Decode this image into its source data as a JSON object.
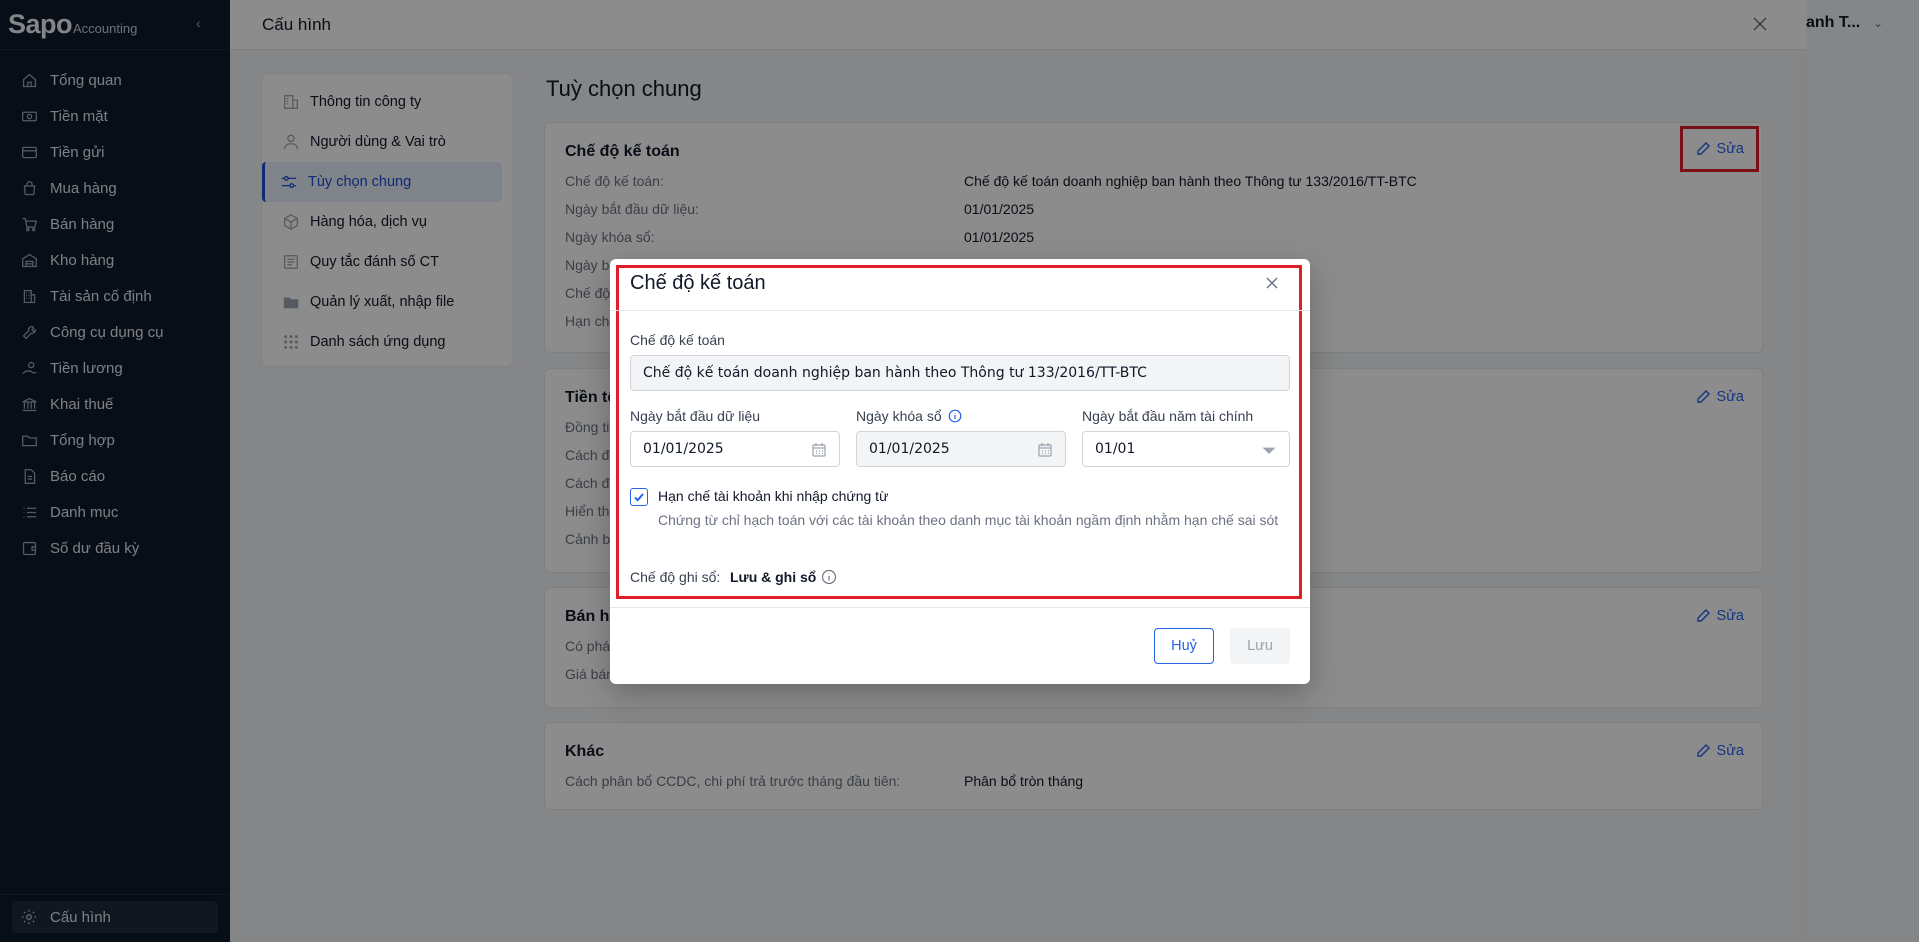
{
  "brand": {
    "logo_main": "Sapo",
    "logo_sub": "Accounting"
  },
  "sidebar": {
    "items": [
      {
        "label": "Tổng quan",
        "icon": "home-icon"
      },
      {
        "label": "Tiền mặt",
        "icon": "cash-icon"
      },
      {
        "label": "Tiền gửi",
        "icon": "card-icon"
      },
      {
        "label": "Mua hàng",
        "icon": "bag-icon"
      },
      {
        "label": "Bán hàng",
        "icon": "cart-icon"
      },
      {
        "label": "Kho hàng",
        "icon": "warehouse-icon"
      },
      {
        "label": "Tài sản cố định",
        "icon": "building-icon"
      },
      {
        "label": "Công cụ dụng cụ",
        "icon": "tool-icon"
      },
      {
        "label": "Tiền lương",
        "icon": "payroll-icon"
      },
      {
        "label": "Khai thuế",
        "icon": "bank-icon"
      },
      {
        "label": "Tổng hợp",
        "icon": "folder-icon"
      },
      {
        "label": "Báo cáo",
        "icon": "report-icon"
      },
      {
        "label": "Danh mục",
        "icon": "list-icon"
      },
      {
        "label": "Số dư đầu kỳ",
        "icon": "wallet-icon"
      }
    ],
    "settings_label": "Cấu hình"
  },
  "topbar": {
    "user_peek": "anh T..."
  },
  "panel": {
    "title": "Cấu hình",
    "subnav": [
      {
        "label": "Thông tin công ty",
        "icon": "company-icon",
        "active": false
      },
      {
        "label": "Người dùng & Vai trò",
        "icon": "user-icon",
        "active": false
      },
      {
        "label": "Tùy chọn chung",
        "icon": "sliders-icon",
        "active": true
      },
      {
        "label": "Hàng hóa, dịch vụ",
        "icon": "box-icon",
        "active": false
      },
      {
        "label": "Quy tắc đánh số CT",
        "icon": "numbering-icon",
        "active": false
      },
      {
        "label": "Quản lý xuất, nhập file",
        "icon": "file-folder-icon",
        "active": false
      },
      {
        "label": "Danh sách ứng dụng",
        "icon": "apps-grid-icon",
        "active": false
      }
    ],
    "content_title": "Tuỳ chọn chung",
    "edit_label": "Sửa",
    "cards": {
      "accounting": {
        "title": "Chế độ kế toán",
        "rows": [
          {
            "label": "Chế độ kế toán:",
            "value": "Chế độ kế toán doanh nghiệp ban hành theo Thông tư 133/2016/TT-BTC"
          },
          {
            "label": "Ngày bắt đầu dữ liệu:",
            "value": "01/01/2025"
          },
          {
            "label": "Ngày khóa sổ:",
            "value": "01/01/2025"
          },
          {
            "label": "Ngày b",
            "value": ""
          },
          {
            "label": "Chế độ",
            "value": ""
          },
          {
            "label": "Hạn ch",
            "value": ""
          }
        ]
      },
      "currency": {
        "title": "Tiền tệ",
        "rows": [
          {
            "label": "Đồng ti"
          },
          {
            "label": "Cách đ"
          },
          {
            "label": "Cách đ"
          },
          {
            "label": "Hiển th"
          },
          {
            "label": "Cảnh b"
          }
        ]
      },
      "sales": {
        "title": "Bán hà",
        "rows": [
          {
            "label": "Có phá"
          },
          {
            "label": "Giá bán"
          }
        ]
      },
      "other": {
        "title": "Khác",
        "rows": [
          {
            "label": "Cách phân bổ CCDC, chi phí trả trước tháng đầu tiên:",
            "value": "Phân bổ tròn tháng"
          }
        ]
      }
    }
  },
  "modal": {
    "title": "Chế độ kế toán",
    "regime_label": "Chế độ kế toán",
    "regime_value": "Chế độ kế toán doanh nghiệp ban hành theo Thông tư 133/2016/TT-BTC",
    "start_date_label": "Ngày bắt đầu dữ liệu",
    "start_date_value": "01/01/2025",
    "lock_date_label": "Ngày khóa sổ",
    "lock_date_value": "01/01/2025",
    "fiscal_start_label": "Ngày bắt đầu năm tài chính",
    "fiscal_start_value": "01/01",
    "restrict_label": "Hạn chế tài khoản khi nhập chứng từ",
    "restrict_checked": true,
    "restrict_desc": "Chứng từ chỉ hạch toán với các tài khoản theo danh mục tài khoản ngầm định nhằm hạn chế sai sót",
    "posting_mode_label": "Chế độ ghi sổ:",
    "posting_mode_value": "Lưu & ghi sổ",
    "cancel_label": "Huỷ",
    "save_label": "Lưu"
  },
  "colors": {
    "sidebar_bg": "#0f1a2b",
    "accent": "#2563eb",
    "highlight": "#e11d2a"
  }
}
